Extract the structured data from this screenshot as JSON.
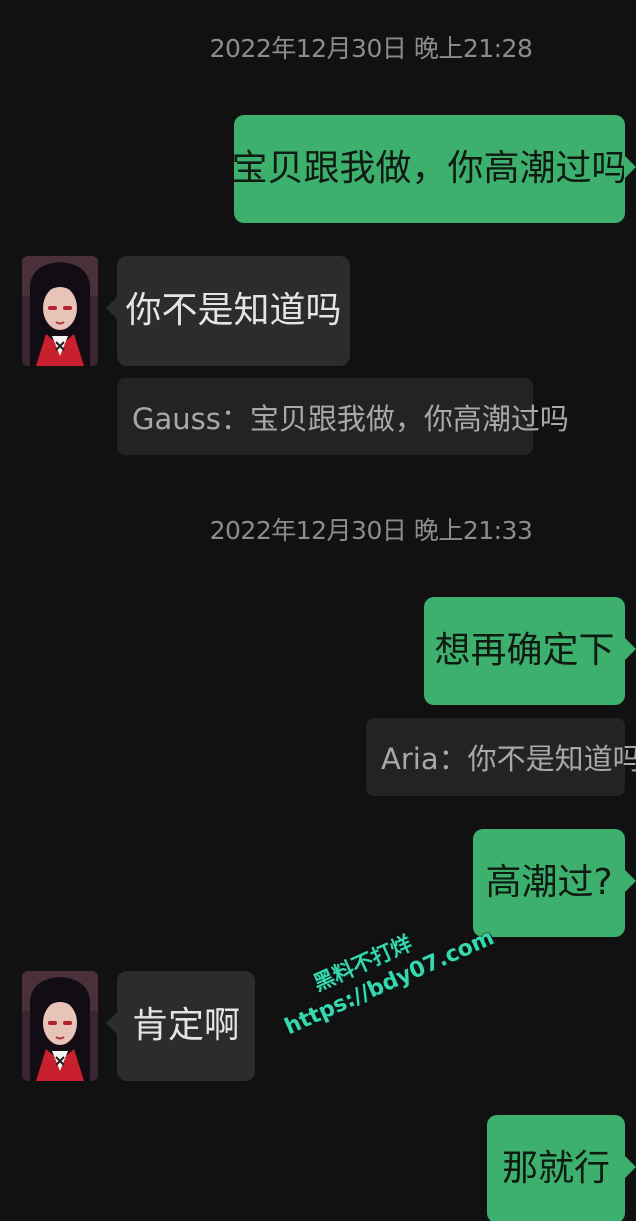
{
  "chat": {
    "messages": [
      {
        "time": "2022年12月30日 晚上21:28"
      },
      {
        "out_text": "宝贝跟我做，你高潮过吗"
      },
      {
        "in_text": "你不是知道吗"
      },
      {
        "quote_text": "Gauss：宝贝跟我做，你高潮过吗"
      },
      {
        "time": "2022年12月30日 晚上21:33"
      },
      {
        "out_text": "想再确定下"
      },
      {
        "quote_text": "Aria：你不是知道吗"
      },
      {
        "out_text": "高潮过?"
      },
      {
        "in_text": "肯定啊"
      },
      {
        "out_text": "那就行"
      }
    ]
  },
  "watermark": {
    "line1": "黑料不打烊",
    "line2": "https://bdy07.com"
  },
  "colors": {
    "background": "#111111",
    "outgoing_bubble": "#3eb06d",
    "incoming_bubble": "#2c2c2c",
    "quote_box": "#232323",
    "watermark": "#37d8b0"
  },
  "icons": {
    "avatar": "anime-girl-avatar"
  }
}
